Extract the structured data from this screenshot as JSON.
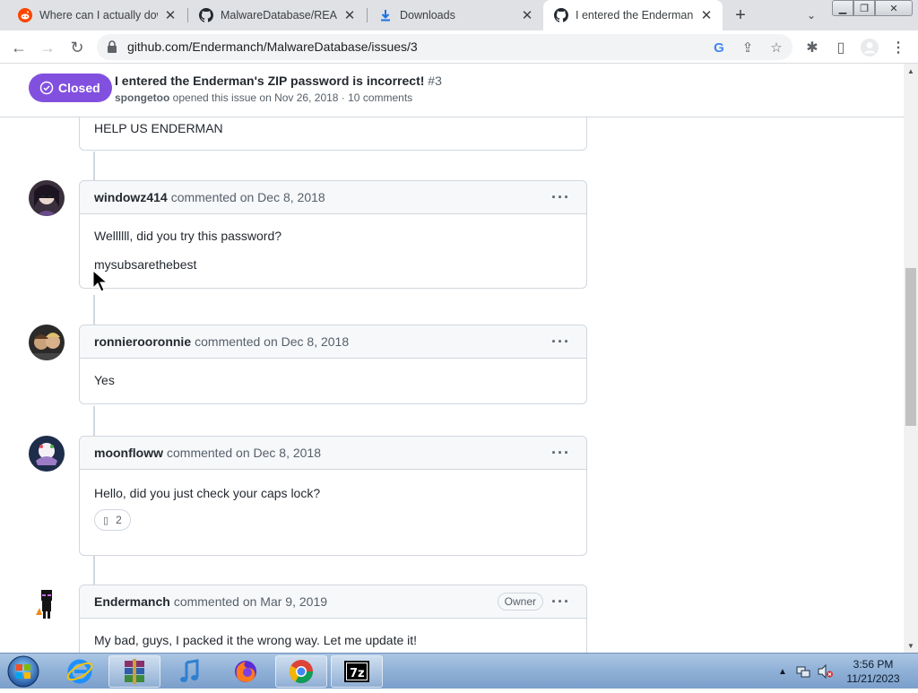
{
  "browser": {
    "tabs": [
      {
        "title": "Where can I actually dow",
        "favicon": "reddit-icon",
        "active": false
      },
      {
        "title": "MalwareDatabase/READM",
        "favicon": "github-icon",
        "active": false
      },
      {
        "title": "Downloads",
        "favicon": "download-icon",
        "active": false
      },
      {
        "title": "I entered the Enderman's",
        "favicon": "github-icon",
        "active": true
      }
    ],
    "url": "github.com/Endermanch/MalwareDatabase/issues/3"
  },
  "issue": {
    "state": "Closed",
    "title": "I entered the Enderman's ZIP password is incorrect!",
    "number": "#3",
    "author": "spongetoo",
    "meta": "opened this issue on Nov 26, 2018 · 10 comments",
    "accent": "#8250df"
  },
  "comments": [
    {
      "body": [
        "HELP US ENDERMAN"
      ]
    },
    {
      "author": "windowz414",
      "action": "commented on Dec 8, 2018",
      "body": [
        "Wellllll, did you try this password?",
        "mysubsarethebest"
      ]
    },
    {
      "author": "ronnierooronnie",
      "action": "commented on Dec 8, 2018",
      "body": [
        "Yes"
      ]
    },
    {
      "author": "moonfloww",
      "action": "commented on Dec 8, 2018",
      "body": [
        "Hello, did you just check your caps lock?"
      ],
      "reaction": {
        "icon": "emoji-icon",
        "count": "2"
      }
    },
    {
      "author": "Endermanch",
      "action": "commented on Mar 9, 2019",
      "badge": "Owner",
      "body": [
        "My bad, guys, I packed it the wrong way. Let me update it!"
      ]
    }
  ],
  "taskbar": {
    "apps": [
      "start-orb",
      "internet-explorer",
      "winrar",
      "itunes",
      "firefox",
      "chrome",
      "7zip"
    ],
    "time": "3:56 PM",
    "date": "11/21/2023"
  }
}
